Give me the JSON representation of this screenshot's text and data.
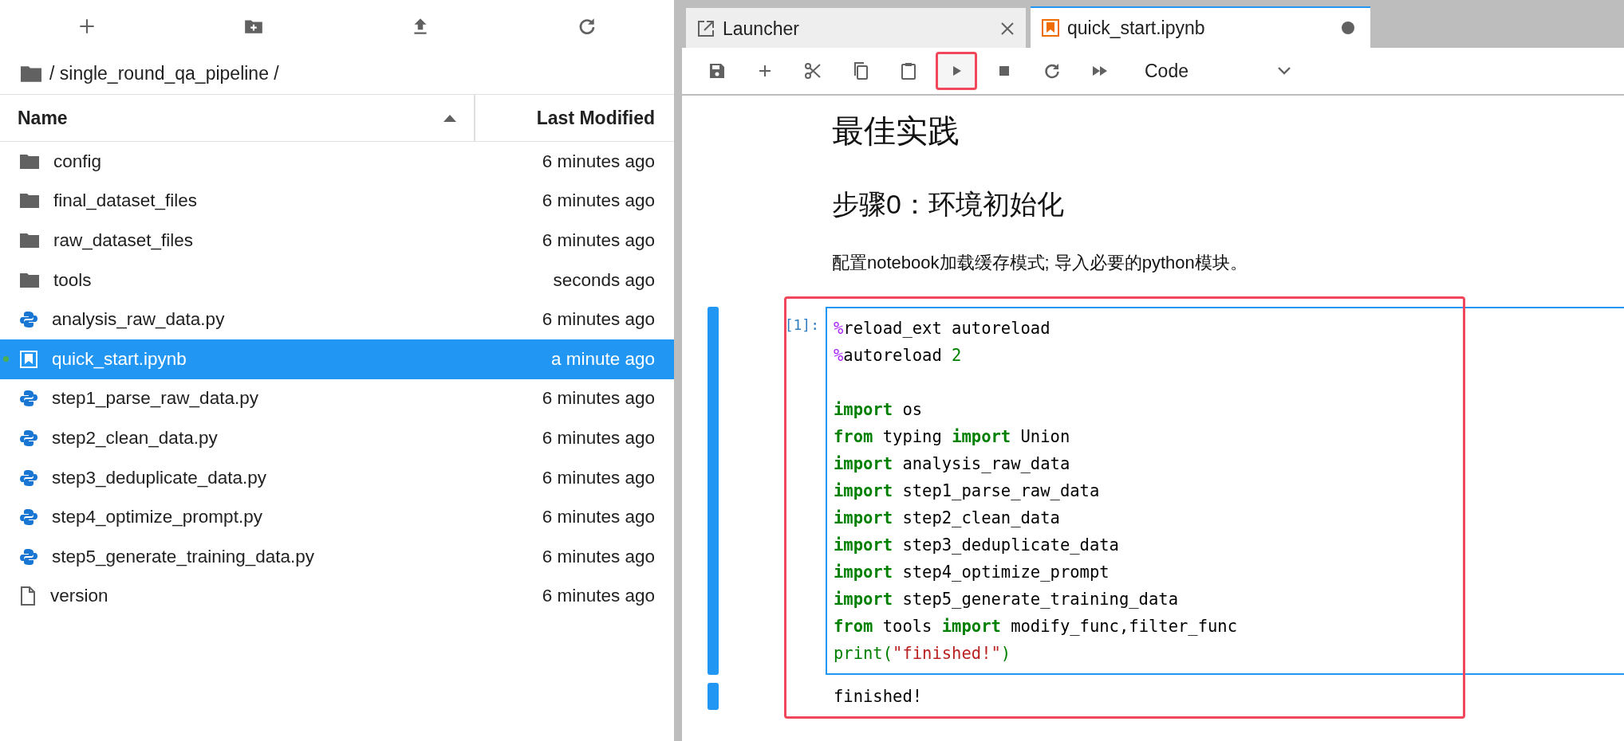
{
  "file_browser": {
    "toolbar": [
      {
        "kind": "new"
      },
      {
        "kind": "new_folder"
      },
      {
        "kind": "upload"
      },
      {
        "kind": "refresh"
      }
    ],
    "breadcrumb": [
      "/ single_round_qa_pipeline /"
    ],
    "columns": [
      {
        "label": "Name",
        "sorted": true
      },
      {
        "label": "Last Modified",
        "sorted": false
      }
    ],
    "items": [
      {
        "name": "config",
        "modified": "6 minutes ago",
        "kind": "folder",
        "selected": false,
        "running": false
      },
      {
        "name": "final_dataset_files",
        "modified": "6 minutes ago",
        "kind": "folder",
        "selected": false,
        "running": false
      },
      {
        "name": "raw_dataset_files",
        "modified": "6 minutes ago",
        "kind": "folder",
        "selected": false,
        "running": false
      },
      {
        "name": "tools",
        "modified": "seconds ago",
        "kind": "folder",
        "selected": false,
        "running": false
      },
      {
        "name": "analysis_raw_data.py",
        "modified": "6 minutes ago",
        "kind": "python",
        "selected": false,
        "running": false
      },
      {
        "name": "quick_start.ipynb",
        "modified": "a minute ago",
        "kind": "notebook",
        "selected": true,
        "running": true
      },
      {
        "name": "step1_parse_raw_data.py",
        "modified": "6 minutes ago",
        "kind": "python",
        "selected": false,
        "running": false
      },
      {
        "name": "step2_clean_data.py",
        "modified": "6 minutes ago",
        "kind": "python",
        "selected": false,
        "running": false
      },
      {
        "name": "step3_deduplicate_data.py",
        "modified": "6 minutes ago",
        "kind": "python",
        "selected": false,
        "running": false
      },
      {
        "name": "step4_optimize_prompt.py",
        "modified": "6 minutes ago",
        "kind": "python",
        "selected": false,
        "running": false
      },
      {
        "name": "step5_generate_training_data.py",
        "modified": "6 minutes ago",
        "kind": "python",
        "selected": false,
        "running": false
      },
      {
        "name": "version",
        "modified": "6 minutes ago",
        "kind": "file",
        "selected": false,
        "running": false
      }
    ]
  },
  "tabs": [
    {
      "label": "Launcher",
      "kind": "launcher",
      "selected": false,
      "dirty": false
    },
    {
      "label": "quick_start.ipynb",
      "kind": "notebook",
      "selected": true,
      "dirty": true
    }
  ],
  "notebook_toolbar": {
    "buttons": [
      {
        "kind": "save",
        "highlighted": false
      },
      {
        "kind": "insert",
        "highlighted": false
      },
      {
        "kind": "cut",
        "highlighted": false
      },
      {
        "kind": "copy",
        "highlighted": false
      },
      {
        "kind": "paste",
        "highlighted": false
      },
      {
        "kind": "run",
        "highlighted": true
      },
      {
        "kind": "stop",
        "highlighted": false
      },
      {
        "kind": "restart",
        "highlighted": false
      },
      {
        "kind": "run_all",
        "highlighted": false
      }
    ],
    "cell_type": "Code"
  },
  "notebook": {
    "heading_1": "最佳实践",
    "heading_2": "步骤0：环境初始化",
    "paragraph": "配置notebook加载缓存模式; 导入必要的python模块。",
    "cell": {
      "prompt": "[1]:",
      "selected": true,
      "highlighted": true,
      "output": "finished!",
      "code_blocks": [
        [
          [
            {
              "t": "%",
              "kind": "magic"
            },
            {
              "t": "reload_ext autoreload",
              "kind": "plain"
            }
          ],
          [
            {
              "t": "%",
              "kind": "magic"
            },
            {
              "t": "autoreload ",
              "kind": "plain"
            },
            {
              "t": "2",
              "kind": "number"
            }
          ]
        ],
        [
          [
            {
              "t": "import",
              "kind": "keyword"
            },
            {
              "t": " os",
              "kind": "plain"
            }
          ],
          [
            {
              "t": "from",
              "kind": "keyword"
            },
            {
              "t": " typing ",
              "kind": "plain"
            },
            {
              "t": "import",
              "kind": "keyword"
            },
            {
              "t": " Union",
              "kind": "plain"
            }
          ],
          [
            {
              "t": "import",
              "kind": "keyword"
            },
            {
              "t": " analysis_raw_data",
              "kind": "plain"
            }
          ],
          [
            {
              "t": "import",
              "kind": "keyword"
            },
            {
              "t": " step1_parse_raw_data",
              "kind": "plain"
            }
          ],
          [
            {
              "t": "import",
              "kind": "keyword"
            },
            {
              "t": " step2_clean_data",
              "kind": "plain"
            }
          ],
          [
            {
              "t": "import",
              "kind": "keyword"
            },
            {
              "t": " step3_deduplicate_data",
              "kind": "plain"
            }
          ],
          [
            {
              "t": "import",
              "kind": "keyword"
            },
            {
              "t": " step4_optimize_prompt",
              "kind": "plain"
            }
          ],
          [
            {
              "t": "import",
              "kind": "keyword"
            },
            {
              "t": " step5_generate_training_data",
              "kind": "plain"
            }
          ],
          [
            {
              "t": "from",
              "kind": "keyword"
            },
            {
              "t": " tools ",
              "kind": "plain"
            },
            {
              "t": "import",
              "kind": "keyword"
            },
            {
              "t": " modify_func,filter_func",
              "kind": "plain"
            }
          ],
          [
            {
              "t": "print(",
              "kind": "builtin"
            },
            {
              "t": "\"finished!\"",
              "kind": "string"
            },
            {
              "t": ")",
              "kind": "builtin"
            }
          ]
        ]
      ]
    }
  }
}
